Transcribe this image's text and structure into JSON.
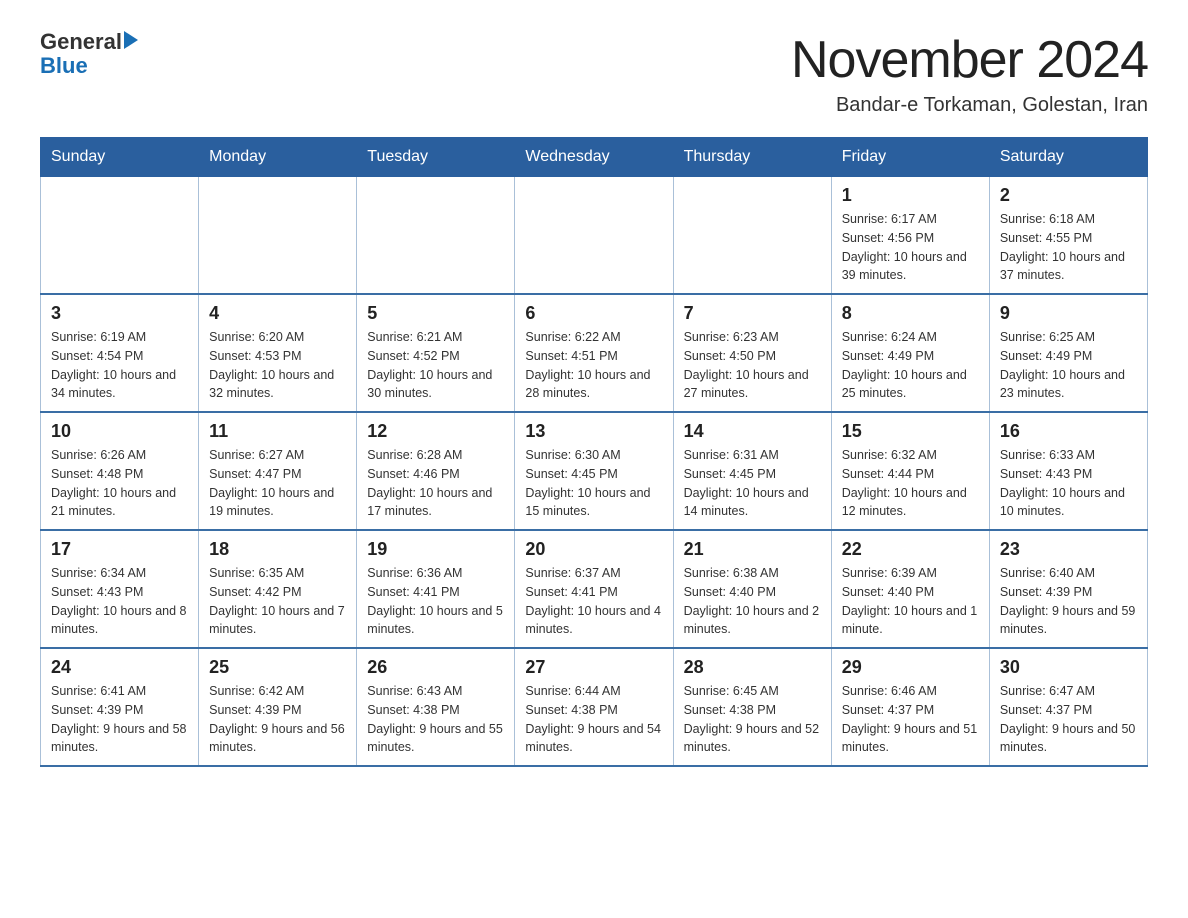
{
  "header": {
    "logo_general": "General",
    "logo_blue": "Blue",
    "month_title": "November 2024",
    "location": "Bandar-e Torkaman, Golestan, Iran"
  },
  "days_of_week": [
    "Sunday",
    "Monday",
    "Tuesday",
    "Wednesday",
    "Thursday",
    "Friday",
    "Saturday"
  ],
  "weeks": [
    [
      {
        "day": "",
        "info": ""
      },
      {
        "day": "",
        "info": ""
      },
      {
        "day": "",
        "info": ""
      },
      {
        "day": "",
        "info": ""
      },
      {
        "day": "",
        "info": ""
      },
      {
        "day": "1",
        "info": "Sunrise: 6:17 AM\nSunset: 4:56 PM\nDaylight: 10 hours and 39 minutes."
      },
      {
        "day": "2",
        "info": "Sunrise: 6:18 AM\nSunset: 4:55 PM\nDaylight: 10 hours and 37 minutes."
      }
    ],
    [
      {
        "day": "3",
        "info": "Sunrise: 6:19 AM\nSunset: 4:54 PM\nDaylight: 10 hours and 34 minutes."
      },
      {
        "day": "4",
        "info": "Sunrise: 6:20 AM\nSunset: 4:53 PM\nDaylight: 10 hours and 32 minutes."
      },
      {
        "day": "5",
        "info": "Sunrise: 6:21 AM\nSunset: 4:52 PM\nDaylight: 10 hours and 30 minutes."
      },
      {
        "day": "6",
        "info": "Sunrise: 6:22 AM\nSunset: 4:51 PM\nDaylight: 10 hours and 28 minutes."
      },
      {
        "day": "7",
        "info": "Sunrise: 6:23 AM\nSunset: 4:50 PM\nDaylight: 10 hours and 27 minutes."
      },
      {
        "day": "8",
        "info": "Sunrise: 6:24 AM\nSunset: 4:49 PM\nDaylight: 10 hours and 25 minutes."
      },
      {
        "day": "9",
        "info": "Sunrise: 6:25 AM\nSunset: 4:49 PM\nDaylight: 10 hours and 23 minutes."
      }
    ],
    [
      {
        "day": "10",
        "info": "Sunrise: 6:26 AM\nSunset: 4:48 PM\nDaylight: 10 hours and 21 minutes."
      },
      {
        "day": "11",
        "info": "Sunrise: 6:27 AM\nSunset: 4:47 PM\nDaylight: 10 hours and 19 minutes."
      },
      {
        "day": "12",
        "info": "Sunrise: 6:28 AM\nSunset: 4:46 PM\nDaylight: 10 hours and 17 minutes."
      },
      {
        "day": "13",
        "info": "Sunrise: 6:30 AM\nSunset: 4:45 PM\nDaylight: 10 hours and 15 minutes."
      },
      {
        "day": "14",
        "info": "Sunrise: 6:31 AM\nSunset: 4:45 PM\nDaylight: 10 hours and 14 minutes."
      },
      {
        "day": "15",
        "info": "Sunrise: 6:32 AM\nSunset: 4:44 PM\nDaylight: 10 hours and 12 minutes."
      },
      {
        "day": "16",
        "info": "Sunrise: 6:33 AM\nSunset: 4:43 PM\nDaylight: 10 hours and 10 minutes."
      }
    ],
    [
      {
        "day": "17",
        "info": "Sunrise: 6:34 AM\nSunset: 4:43 PM\nDaylight: 10 hours and 8 minutes."
      },
      {
        "day": "18",
        "info": "Sunrise: 6:35 AM\nSunset: 4:42 PM\nDaylight: 10 hours and 7 minutes."
      },
      {
        "day": "19",
        "info": "Sunrise: 6:36 AM\nSunset: 4:41 PM\nDaylight: 10 hours and 5 minutes."
      },
      {
        "day": "20",
        "info": "Sunrise: 6:37 AM\nSunset: 4:41 PM\nDaylight: 10 hours and 4 minutes."
      },
      {
        "day": "21",
        "info": "Sunrise: 6:38 AM\nSunset: 4:40 PM\nDaylight: 10 hours and 2 minutes."
      },
      {
        "day": "22",
        "info": "Sunrise: 6:39 AM\nSunset: 4:40 PM\nDaylight: 10 hours and 1 minute."
      },
      {
        "day": "23",
        "info": "Sunrise: 6:40 AM\nSunset: 4:39 PM\nDaylight: 9 hours and 59 minutes."
      }
    ],
    [
      {
        "day": "24",
        "info": "Sunrise: 6:41 AM\nSunset: 4:39 PM\nDaylight: 9 hours and 58 minutes."
      },
      {
        "day": "25",
        "info": "Sunrise: 6:42 AM\nSunset: 4:39 PM\nDaylight: 9 hours and 56 minutes."
      },
      {
        "day": "26",
        "info": "Sunrise: 6:43 AM\nSunset: 4:38 PM\nDaylight: 9 hours and 55 minutes."
      },
      {
        "day": "27",
        "info": "Sunrise: 6:44 AM\nSunset: 4:38 PM\nDaylight: 9 hours and 54 minutes."
      },
      {
        "day": "28",
        "info": "Sunrise: 6:45 AM\nSunset: 4:38 PM\nDaylight: 9 hours and 52 minutes."
      },
      {
        "day": "29",
        "info": "Sunrise: 6:46 AM\nSunset: 4:37 PM\nDaylight: 9 hours and 51 minutes."
      },
      {
        "day": "30",
        "info": "Sunrise: 6:47 AM\nSunset: 4:37 PM\nDaylight: 9 hours and 50 minutes."
      }
    ]
  ]
}
